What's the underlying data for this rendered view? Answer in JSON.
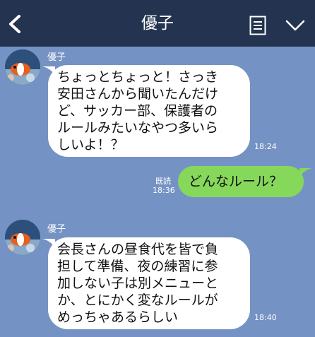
{
  "header": {
    "title": "優子",
    "back_icon": "chevron-left-icon",
    "memo_icon": "memo-list-icon",
    "menu_icon": "chevron-down-icon",
    "background_color": "#233350"
  },
  "chat": {
    "background_color": "#7493c4",
    "messages": [
      {
        "sender": "優子",
        "direction": "incoming",
        "text": "ちょっとちょっと！さっき\n安田さんから聞いたんだけ\nど、サッカー部、保護者の\nルールみたいなやつ多いら\nしいよ！？",
        "time": "18:24"
      },
      {
        "direction": "outgoing",
        "text": "どんなルール？",
        "read_label": "既読",
        "time": "18:36",
        "bubble_color": "#86d85b"
      },
      {
        "sender": "優子",
        "direction": "incoming",
        "text": "会長さんの昼食代を皆で負\n担して準備、夜の練習に参\n加しない子は別メニューと\nか、とにかく変なルールが\nめっちゃあるらしい",
        "time": "18:40"
      }
    ]
  }
}
